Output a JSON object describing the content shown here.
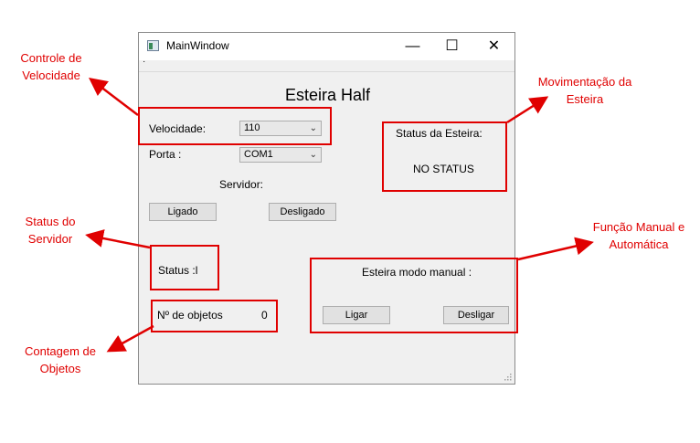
{
  "window": {
    "title": "MainWindow",
    "minimize": "—",
    "maximize": "☐",
    "close": "✕",
    "menu_dot": "·"
  },
  "main": {
    "heading": "Esteira Half",
    "velocidade_label": "Velocidade:",
    "velocidade_value": "110",
    "porta_label": "Porta :",
    "porta_value": "COM1",
    "servidor_label": "Servidor:",
    "ligado_button": "Ligado",
    "desligado_button": "Desligado",
    "status_label": "Status :l",
    "objetos_label": "Nº de objetos",
    "objetos_count": "0",
    "status_esteira_label": "Status da Esteira:",
    "status_esteira_value": "NO STATUS",
    "modo_manual_label": "Esteira modo manual :",
    "ligar_button": "Ligar",
    "desligar_button": "Desligar"
  },
  "annotations": {
    "controle_velocidade": [
      "Controle de",
      "Velocidade"
    ],
    "status_servidor": [
      "Status do",
      "Servidor"
    ],
    "contagem_objetos": [
      "Contagem de",
      "Objetos"
    ],
    "movimentacao_esteira": [
      "Movimentação da",
      "Esteira"
    ],
    "funcao_manual": [
      "Função Manual e",
      "Automática"
    ]
  },
  "colors": {
    "annotation_red": "#e00000",
    "window_bg": "#f0f0f0"
  },
  "icons": {
    "combo_arrow": "chevron-down-icon",
    "app": "app-window-icon"
  }
}
